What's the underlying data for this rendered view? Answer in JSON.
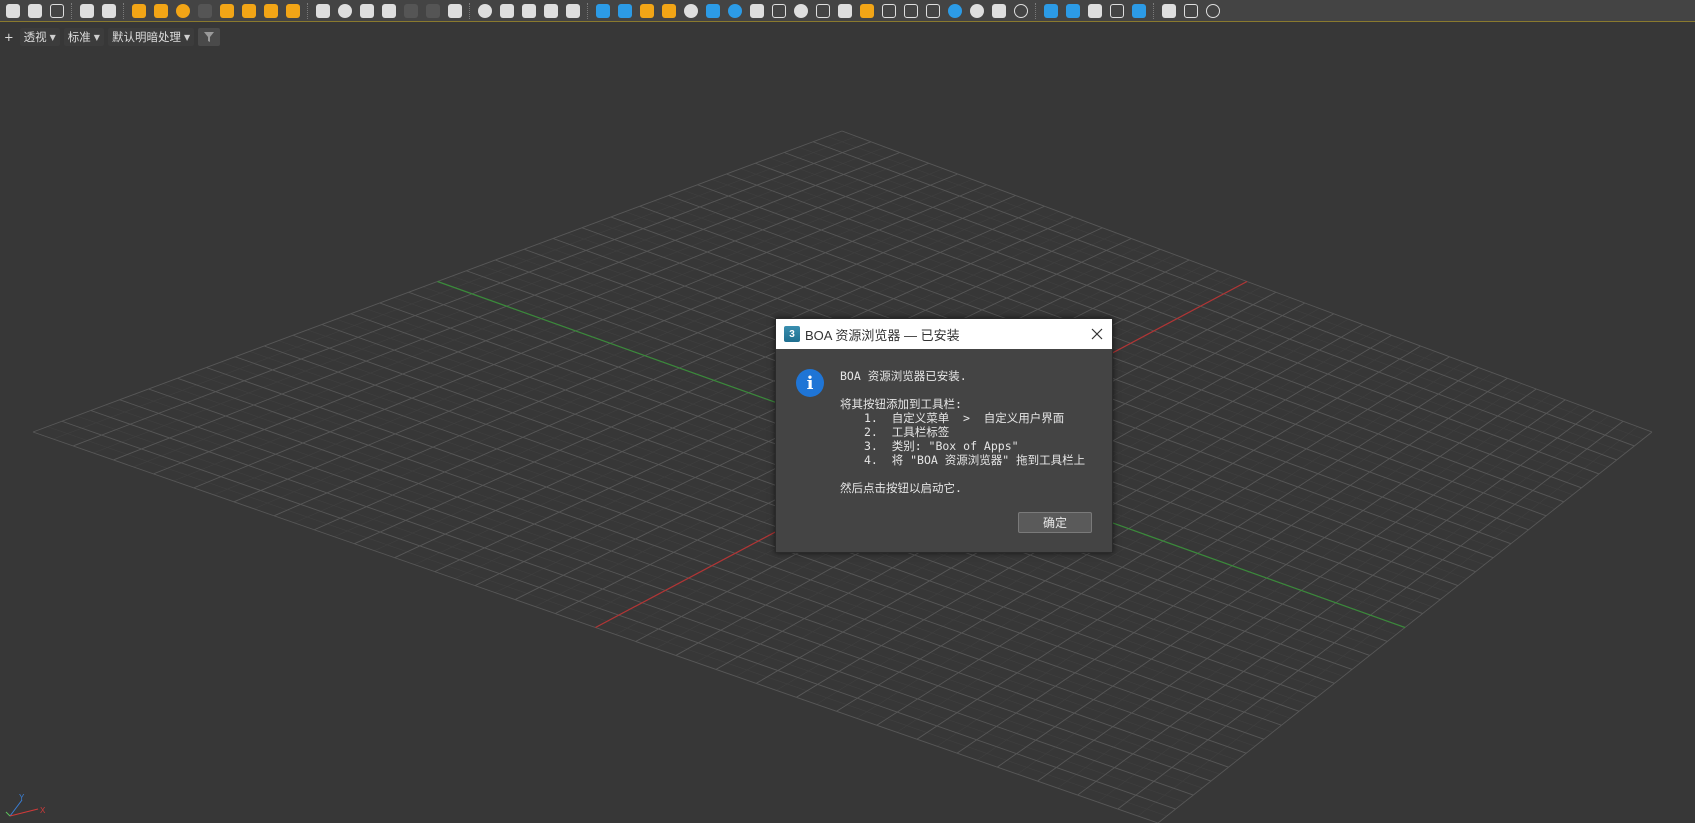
{
  "toolbar": {
    "icons": [
      "teapot-render-icon",
      "render-iterative-icon",
      "render-frame-window-icon",
      "scene-explorer-icon",
      "material-editor-icon",
      "omni-light-icon",
      "dome-light-icon",
      "sphere-light-icon",
      "disabled-light-icon",
      "spot-light-icon",
      "ies-light-icon",
      "sun-light-icon",
      "sun-sky-icon",
      "box-object-icon",
      "material-ball-icon",
      "particles-icon",
      "terrain-icon",
      "disabled-object-a-icon",
      "disabled-object-b-icon",
      "settings-gear-icon",
      "sphere-icon",
      "multi-material-icon",
      "palette-icon",
      "texture-icon",
      "vray-logo-icon",
      "camera-icon",
      "physical-camera-icon",
      "light-bulb-icon",
      "sun-small-icon",
      "moon-icon",
      "pine-tree-icon",
      "refresh-icon",
      "layers-icon",
      "document-icon",
      "rotate-icon",
      "frame-icon",
      "brush-icon",
      "bulb-outline-icon",
      "panel-icon",
      "panel-b-icon",
      "grid-icon",
      "eye-icon",
      "globe-icon",
      "hdri-icon",
      "help-icon",
      "dots-a-icon",
      "target-icon",
      "transform-icon",
      "select-box-icon",
      "snap-icon",
      "trees-icon",
      "notes-icon",
      "help-circle-icon"
    ],
    "colors": {
      "background": "#444444",
      "orange": "#f2a516",
      "blue": "#2c9be6",
      "white": "#dedede",
      "gray": "#555555"
    }
  },
  "viewport_labels": {
    "plus": "+",
    "view": "透视",
    "shading": "标准",
    "lighting": "默认明暗处理"
  },
  "dialog": {
    "app_icon_label": "3",
    "title": "BOA 资源浏览器  —  已安装",
    "message": {
      "line1": "BOA 资源浏览器已安装.",
      "line2": "将其按钮添加到工具栏:",
      "steps": [
        "1.  自定义菜单  >  自定义用户界面",
        "2.  工具栏标签",
        "3.  类别: \"Box of Apps\"",
        "4.  将 \"BOA 资源浏览器\" 拖到工具栏上"
      ],
      "line3": "然后点击按钮以启动它."
    },
    "ok_label": "确定"
  },
  "axis_gizmo": {
    "y_label": "Y",
    "x_label": "X"
  }
}
